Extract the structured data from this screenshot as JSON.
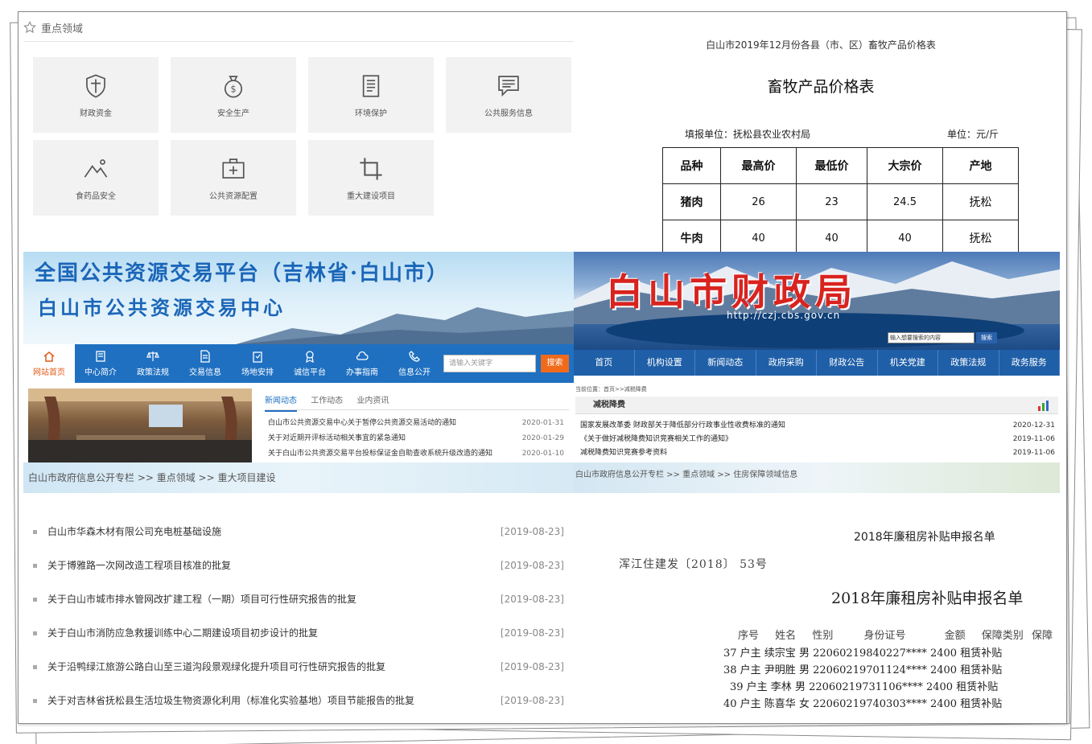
{
  "key_areas": {
    "header": "重点领域",
    "tiles": [
      {
        "label": "财政资金",
        "icon": "shield-icon"
      },
      {
        "label": "安全生产",
        "icon": "money-bag-icon"
      },
      {
        "label": "环境保护",
        "icon": "document-icon"
      },
      {
        "label": "公共服务信息",
        "icon": "chat-icon"
      },
      {
        "label": "食药品安全",
        "icon": "mountain-icon"
      },
      {
        "label": "公共资源配置",
        "icon": "medkit-icon"
      },
      {
        "label": "重大建设项目",
        "icon": "crop-icon"
      }
    ]
  },
  "price_table": {
    "caption": "白山市2019年12月份各县（市、区）畜牧产品价格表",
    "title": "畜牧产品价格表",
    "reporter": "填报单位：抚松县农业农村局",
    "unit": "单位：元/斤",
    "columns": [
      "品种",
      "最高价",
      "最低价",
      "大宗价",
      "产地"
    ],
    "rows": [
      [
        "猪肉",
        "26",
        "23",
        "24.5",
        "抚松"
      ],
      [
        "牛肉",
        "40",
        "40",
        "40",
        "抚松"
      ]
    ]
  },
  "trade": {
    "title1": "全国公共资源交易平台（吉林省·白山市）",
    "title2": "白山市公共资源交易中心",
    "nav": [
      "网站首页",
      "中心简介",
      "政策法规",
      "交易信息",
      "场地安排",
      "诚信平台",
      "办事指南",
      "信息公开"
    ],
    "search_placeholder": "请输入关键字",
    "search_button": "搜索",
    "tabs": [
      "新闻动态",
      "工作动态",
      "业内资讯"
    ],
    "news": [
      {
        "title": "白山市公共资源交易中心关于暂停公共资源交易活动的通知",
        "date": "2020-01-31"
      },
      {
        "title": "关于对近期开评标活动相关事宜的紧急通知",
        "date": "2020-01-29"
      },
      {
        "title": "关于白山市公共资源交易平台投标保证金自助查收系统升级改造的通知",
        "date": "2020-01-10"
      }
    ],
    "breadcrumb": "白山市政府信息公开专栏 >> 重点领域 >> 重大项目建设"
  },
  "finance": {
    "logo": "白山市财政局",
    "url": "http://czj.cbs.gov.cn",
    "search_placeholder": "输入想要搜索的内容",
    "search_button": "搜索",
    "nav": [
      "首页",
      "机构设置",
      "新闻动态",
      "政府采购",
      "财政公告",
      "机关党建",
      "政策法规",
      "政务服务"
    ],
    "location": "当前位置：首页>>减税降费",
    "section": "减税降费",
    "rows": [
      {
        "title": "国家发展改革委 财政部关于降低部分行政事业性收费标准的通知",
        "date": "2020-12-31"
      },
      {
        "title": "《关于做好减税降费知识竞赛相关工作的通知》",
        "date": "2019-11-06"
      },
      {
        "title": "减税降费知识竞赛参考资料",
        "date": "2019-11-06"
      }
    ],
    "breadcrumb": "白山市政府信息公开专栏 >> 重点领域 >> 住房保障领域信息"
  },
  "projects": {
    "items": [
      {
        "title": "白山市华森木材有限公司充电桩基础设施",
        "date": "[2019-08-23]"
      },
      {
        "title": "关于博雅路一次网改造工程项目核准的批复",
        "date": "[2019-08-23]"
      },
      {
        "title": "关于白山市城市排水管网改扩建工程（一期）项目可行性研究报告的批复",
        "date": "[2019-08-23]"
      },
      {
        "title": "关于白山市消防应急救援训练中心二期建设项目初步设计的批复",
        "date": "[2019-08-23]"
      },
      {
        "title": "关于沿鸭绿江旅游公路白山至三道沟段景观绿化提升项目可行性研究报告的批复",
        "date": "[2019-08-23]"
      },
      {
        "title": "关于对吉林省抚松县生活垃圾生物资源化利用（标准化实验基地）项目节能报告的批复",
        "date": "[2019-08-23]"
      }
    ]
  },
  "rent": {
    "heading": "2018年廉租房补贴申报名单",
    "doc_no": "浑江住建发〔2018〕 53号",
    "title": "2018年廉租房补贴申报名单",
    "columns": [
      "序号",
      "姓名",
      "性别",
      "身份证号",
      "金额",
      "保障类别",
      "保障"
    ],
    "rows": [
      "37 户主 续宗宝 男 22060219840227**** 2400 租赁补贴 ",
      "38 户主 尹明胜 男 22060219701124**** 2400 租赁补贴 ",
      "39 户主 李林 男 22060219731106**** 2400 租赁补贴 ",
      "40 户主 陈喜华 女 22060219740303**** 2400 租赁补贴 "
    ]
  }
}
